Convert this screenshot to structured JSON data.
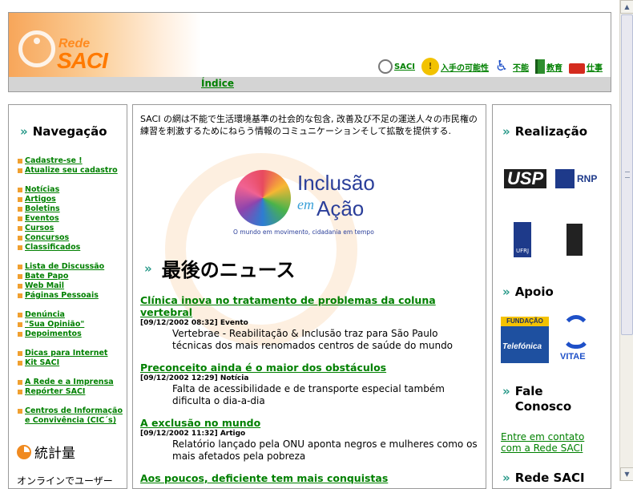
{
  "header": {
    "logo_small": "Rede",
    "logo_big": "SACI",
    "links": [
      {
        "icon": "saci-icon",
        "label": "SACI"
      },
      {
        "icon": "accessibility-icon",
        "label": "入手の可能性"
      },
      {
        "icon": "wheelchair-icon",
        "label": "不能"
      },
      {
        "icon": "book-icon",
        "label": "教育"
      },
      {
        "icon": "briefcase-icon",
        "label": "仕事"
      }
    ],
    "index_link": "Índice"
  },
  "left": {
    "title": "Navegação",
    "groups": [
      [
        "Cadastre-se !",
        "Atualize seu cadastro"
      ],
      [
        "Notícias",
        "Artigos",
        "Boletins",
        "Eventos",
        "Cursos",
        "Concursos",
        "Classificados"
      ],
      [
        "Lista de Discussão",
        "Bate Papo",
        "Web Mail",
        "Páginas Pessoais"
      ],
      [
        "Denúncia",
        "\"Sua Opinião\"",
        "Depoimentos"
      ],
      [
        "Dicas para Internet",
        "Kit SACI"
      ],
      [
        "A Rede e a Imprensa",
        "Repórter SACI"
      ],
      [
        "Centros de Informação e Convivência (CIC´s)"
      ]
    ],
    "stats_title": "統計量",
    "online_text": "オンラインでユーザー"
  },
  "center": {
    "intro": "SACI の網は不能で生活環境基準の社会的な包含, 改善及び不足の運送人々の市民権の練習を刺激するためにねらう情報のコミュニケーションそして拡散を提供する.",
    "banner": {
      "line1": "Inclusão",
      "em": "em",
      "line2": "Ação",
      "tagline": "O mundo em movimento, cidadania em tempo"
    },
    "news_heading": "最後のニュース",
    "news": [
      {
        "title": "Clínica inova no tratamento de problemas da coluna vertebral",
        "date": "[09/12/2002 08:32]",
        "type": "Evento",
        "desc": "Vertebrae - Reabilitação & Inclusão traz para São Paulo técnicas dos mais renomados centros de saúde do mundo"
      },
      {
        "title": "Preconceito ainda é o maior dos obstáculos",
        "date": "[09/12/2002 12:29]",
        "type": "Notícia",
        "desc": "Falta de acessibilidade e de transporte especial também dificulta o dia-a-dia"
      },
      {
        "title": "A exclusão no mundo",
        "date": "[09/12/2002 11:32]",
        "type": "Artigo",
        "desc": "Relatório lançado pela ONU aponta negros e mulheres como os mais afetados pela pobreza"
      },
      {
        "title": "Aos poucos, deficiente tem mais conquistas",
        "date": "",
        "type": "",
        "desc": ""
      }
    ]
  },
  "right": {
    "realizacao_title": "Realização",
    "logos": {
      "usp": "USP",
      "rnp": "RNP",
      "ufrj": "UFRJ",
      "fundacao": "FUNDAÇÃO",
      "telefonica": "Telefónica",
      "vitae": "VITAE"
    },
    "apoio_title": "Apoio",
    "fale_title": "Fale Conosco",
    "contact_link": "Entre em contato com a Rede SACI",
    "rede_title": "Rede SACI"
  }
}
